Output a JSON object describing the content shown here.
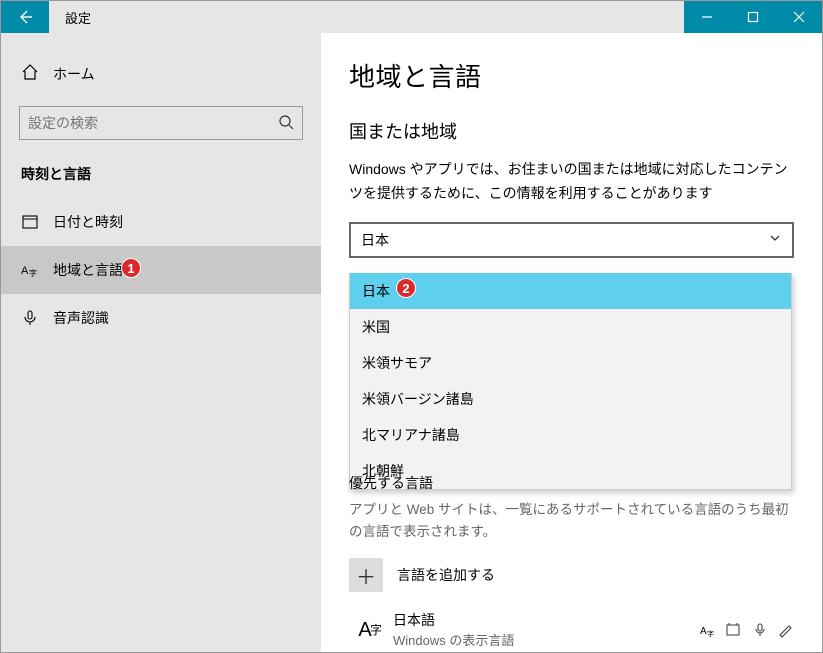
{
  "titlebar": {
    "title": "設定"
  },
  "sidebar": {
    "home": "ホーム",
    "search_placeholder": "設定の検索",
    "category": "時刻と言語",
    "items": [
      {
        "label": "日付と時刻"
      },
      {
        "label": "地域と言語"
      },
      {
        "label": "音声認識"
      }
    ]
  },
  "callouts": {
    "nav_region": "1",
    "dropdown_japan": "2"
  },
  "content": {
    "page_heading": "地域と言語",
    "section_heading": "国または地域",
    "section_sub": "Windows やアプリでは、お住まいの国または地域に対応したコンテンツを提供するために、この情報を利用することがあります",
    "combo_value": "日本",
    "dropdown": [
      "日本",
      "米国",
      "米領サモア",
      "米領バージン諸島",
      "北マリアナ諸島",
      "北朝鮮"
    ],
    "pref_title": "優先する言語",
    "pref_sub": "アプリと Web サイトは、一覧にあるサポートされている言語のうち最初の言語で表示されます。",
    "add_language": "言語を追加する",
    "language_entry": {
      "name": "日本語",
      "sub": "Windows の表示言語"
    },
    "lang_icon": {
      "big": "A",
      "small": "字"
    }
  }
}
